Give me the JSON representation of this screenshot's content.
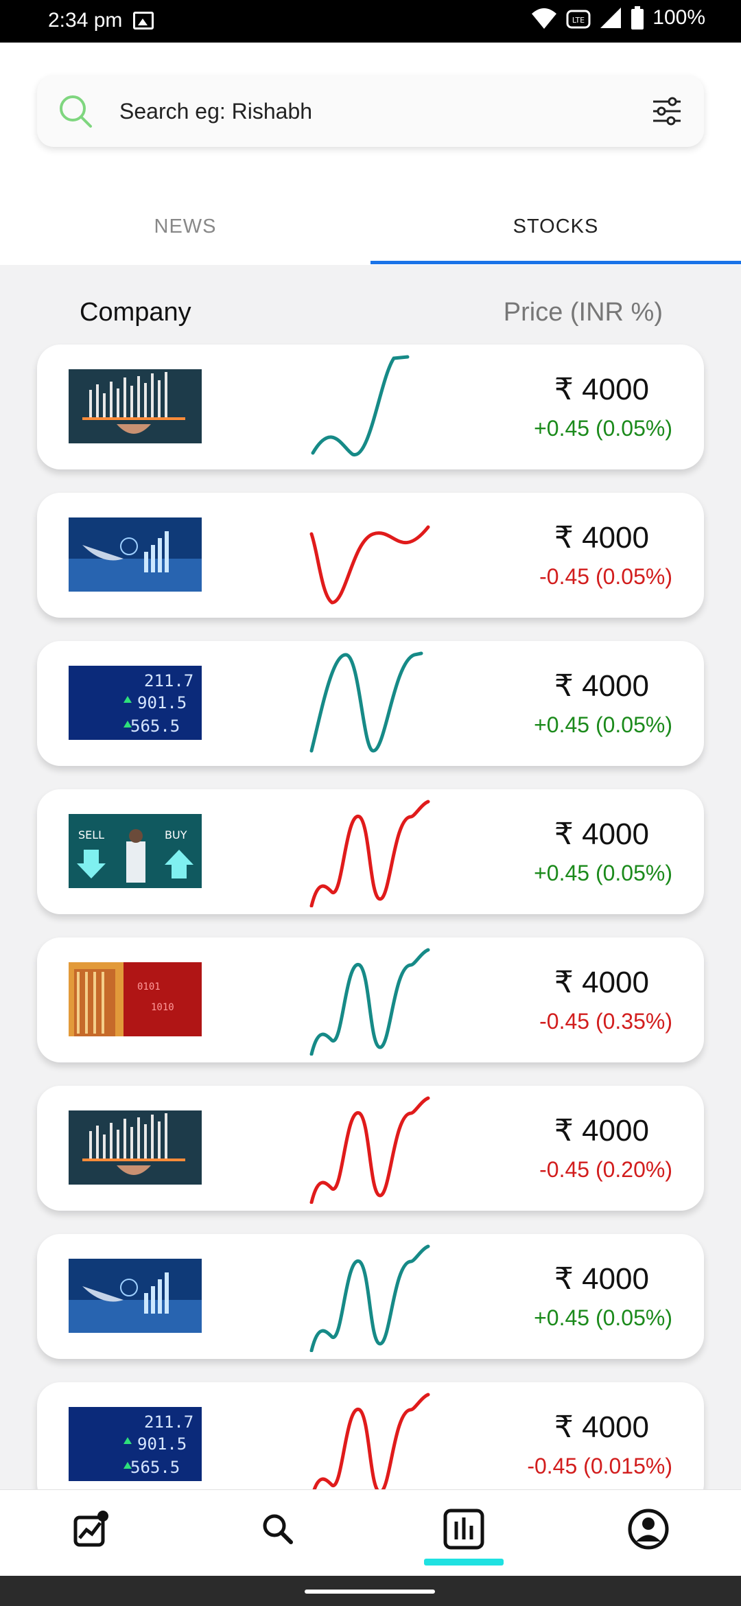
{
  "status": {
    "time": "2:34 pm",
    "battery": "100%"
  },
  "search": {
    "placeholder": "Search eg: Rishabh"
  },
  "tabs": [
    {
      "label": "NEWS",
      "active": false
    },
    {
      "label": "STOCKS",
      "active": true
    }
  ],
  "header": {
    "company": "Company",
    "price": "Price (INR %)"
  },
  "colors": {
    "up": "#1b8a1b",
    "down": "#d21d1d",
    "teal": "#168a87",
    "red": "#e01b1b",
    "tab_active": "#1a73e8",
    "nav_active": "#1fe1e1"
  },
  "stocks": [
    {
      "price": "₹ 4000",
      "change": "+0.45 (0.05%)",
      "direction": "up",
      "trend": "teal",
      "image": "finance-hand-chart"
    },
    {
      "price": "₹ 4000",
      "change": "-0.45 (0.05%)",
      "direction": "down",
      "trend": "red",
      "image": "finance-laptop-chart"
    },
    {
      "price": "₹ 4000",
      "change": "+0.45 (0.05%)",
      "direction": "up",
      "trend": "teal",
      "image": "stock-ticker-numbers"
    },
    {
      "price": "₹ 4000",
      "change": "+0.45 (0.05%)",
      "direction": "up",
      "trend": "red",
      "image": "sell-buy-trader"
    },
    {
      "price": "₹ 4000",
      "change": "-0.45 (0.35%)",
      "direction": "down",
      "trend": "teal",
      "image": "stock-exchange-building"
    },
    {
      "price": "₹ 4000",
      "change": "-0.45 (0.20%)",
      "direction": "down",
      "trend": "red",
      "image": "finance-hand-chart"
    },
    {
      "price": "₹ 4000",
      "change": "+0.45 (0.05%)",
      "direction": "up",
      "trend": "teal",
      "image": "finance-laptop-chart"
    },
    {
      "price": "₹ 4000",
      "change": "-0.45 (0.015%)",
      "direction": "down",
      "trend": "red",
      "image": "stock-ticker-numbers"
    }
  ],
  "bottom_nav": [
    {
      "icon": "trending-chart-icon",
      "active": false
    },
    {
      "icon": "search-icon",
      "active": false
    },
    {
      "icon": "bar-chart-icon",
      "active": true
    },
    {
      "icon": "profile-icon",
      "active": false
    }
  ]
}
